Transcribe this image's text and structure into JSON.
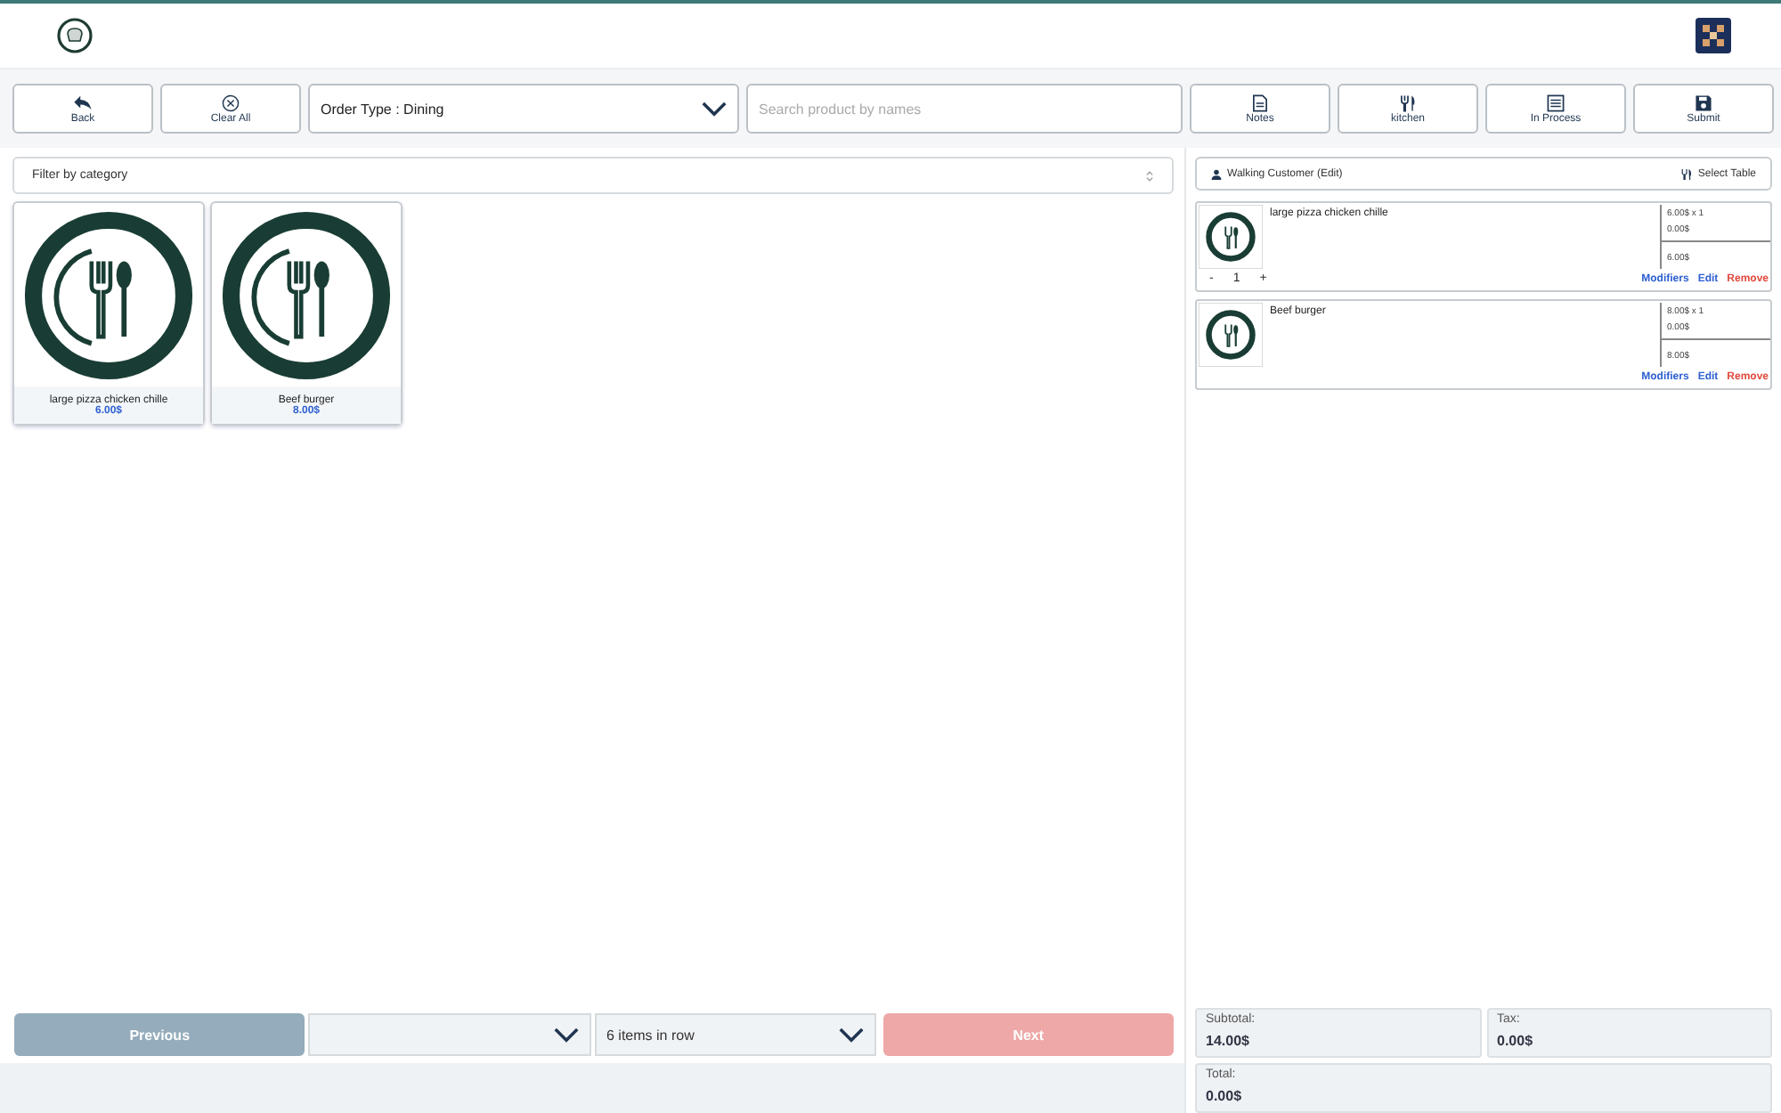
{
  "toolbar": {
    "buttons": [
      {
        "kind": "back",
        "label": "Back"
      },
      {
        "kind": "clear",
        "label": "Clear All"
      }
    ],
    "order_type": {
      "value": "Order Type : Dining"
    },
    "search": {
      "placeholder": "Search product by names"
    },
    "actions": [
      {
        "kind": "notes",
        "label": "Notes"
      },
      {
        "kind": "kitchen",
        "label": "kitchen"
      },
      {
        "kind": "list",
        "label": "In Process"
      },
      {
        "kind": "save",
        "label": "Submit"
      }
    ]
  },
  "filter": {
    "placeholder": "Filter by category"
  },
  "products": [
    {
      "name": "large pizza chicken chille",
      "price": "6.00$"
    },
    {
      "name": "Beef burger",
      "price": "8.00$"
    }
  ],
  "pager": {
    "previous": "Previous",
    "per_row": {
      "value": "6 items in row"
    },
    "next": "Next"
  },
  "cart": {
    "customer": "Walking Customer (Edit)",
    "select_table": "Select Table",
    "items": [
      {
        "name": "large pizza chicken chille",
        "unit": "6.00$ x 1",
        "extra": "0.00$",
        "total": "6.00$",
        "minus": "-",
        "qty": "1",
        "plus": "+",
        "modifiers": "Modifiers",
        "edit": "Edit",
        "remove": "Remove"
      },
      {
        "name": "Beef burger",
        "unit": "8.00$ x 1",
        "extra": "0.00$",
        "total": "8.00$",
        "modifiers": "Modifiers",
        "edit": "Edit",
        "remove": "Remove"
      }
    ],
    "totals": [
      {
        "label": "Subtotal:",
        "value": "14.00$"
      },
      {
        "label": "Tax:",
        "value": "0.00$"
      },
      {
        "label": "Total:",
        "value": "0.00$"
      }
    ]
  }
}
